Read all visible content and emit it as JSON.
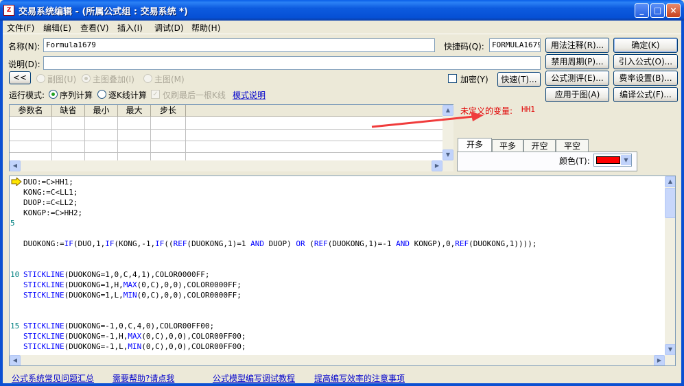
{
  "window": {
    "title": "交易系统编辑 - (所属公式组 : 交易系统 *)",
    "app_icon_label": "Z",
    "minimize": "_",
    "maximize": "□",
    "close": "×"
  },
  "menu": [
    "文件(F)",
    "编辑(E)",
    "查看(V)",
    "插入(I)",
    "调试(D)",
    "帮助(H)"
  ],
  "form": {
    "name_label": "名称(N):",
    "name_value": "Formula1679",
    "shortcut_label": "快捷码(Q):",
    "shortcut_value": "FORMULA1679",
    "desc_label": "说明(D):",
    "desc_value": "",
    "collapse_btn": "<<",
    "radio_sub": "副图(U)",
    "radio_main_overlay": "主图叠加(I)",
    "radio_main": "主图(M)",
    "encrypt_label": "加密(Y)",
    "quick_btn": "快速(T)...",
    "run_mode_label": "运行模式:",
    "run_seq": "序列计算",
    "run_kline": "逐K线计算",
    "only_last": "仅刷最后一根K线",
    "mode_help_link": "模式说明"
  },
  "buttons": {
    "usage": "用法注释(R)...",
    "ok": "确定(K)",
    "disable_period": "禁用周期(P)...",
    "import": "引入公式(O)...",
    "evaluate": "公式测评(E)...",
    "fee": "费率设置(B)...",
    "apply": "应用于图(A)",
    "compile": "编译公式(F)..."
  },
  "params": {
    "columns": [
      "参数名",
      "缺省",
      "最小",
      "最大",
      "步长"
    ],
    "rows": []
  },
  "undefined_var": {
    "label": "未定义的变量:",
    "value": "HH1"
  },
  "signal_tabs": [
    "开多",
    "平多",
    "开空",
    "平空"
  ],
  "active_tab": "开多",
  "color": {
    "label": "颜色(T):",
    "value": "#FF0000"
  },
  "code_lines": [
    {
      "num": "",
      "arrow": true,
      "text": "DUO:=C>HH1;"
    },
    {
      "num": "",
      "text": "KONG:=C<LL1;"
    },
    {
      "num": "",
      "text": "DUOP:=C<LL2;"
    },
    {
      "num": "",
      "text": "KONGP:=C>HH2;"
    },
    {
      "num": "5",
      "text": ""
    },
    {
      "num": "",
      "text": ""
    },
    {
      "num": "",
      "text": "DUOKONG:=IF(DUO,1,IF(KONG,-1,IF((REF(DUOKONG,1)=1 AND DUOP) OR (REF(DUOKONG,1)=-1 AND KONGP),0,REF(DUOKONG,1))));"
    },
    {
      "num": "",
      "text": ""
    },
    {
      "num": "",
      "text": ""
    },
    {
      "num": "10",
      "text": "STICKLINE(DUOKONG=1,0,C,4,1),COLOR0000FF;"
    },
    {
      "num": "",
      "text": "STICKLINE(DUOKONG=1,H,MAX(0,C),0,0),COLOR0000FF;"
    },
    {
      "num": "",
      "text": "STICKLINE(DUOKONG=1,L,MIN(0,C),0,0),COLOR0000FF;"
    },
    {
      "num": "",
      "text": ""
    },
    {
      "num": "",
      "text": ""
    },
    {
      "num": "15",
      "text": "STICKLINE(DUOKONG=-1,0,C,4,0),COLOR00FF00;"
    },
    {
      "num": "",
      "text": "STICKLINE(DUOKONG=-1,H,MAX(0,C),0,0),COLOR00FF00;"
    },
    {
      "num": "",
      "text": "STICKLINE(DUOKONG=-1,L,MIN(0,C),0,0),COLOR00FF00;"
    }
  ],
  "footer_links": [
    "公式系统常见问题汇总",
    "需要帮助?请点我",
    "公式模型编写调试教程",
    "提高编写效率的注意事项"
  ]
}
